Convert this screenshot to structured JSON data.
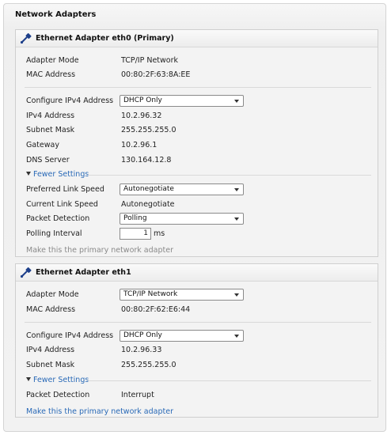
{
  "page": {
    "title": "Network Adapters"
  },
  "eth0": {
    "title": "Ethernet Adapter eth0 (Primary)",
    "adapter_mode_label": "Adapter Mode",
    "adapter_mode_value": "TCP/IP Network",
    "mac_label": "MAC Address",
    "mac_value": "00:80:2F:63:8A:EE",
    "configure_label": "Configure IPv4 Address",
    "configure_value": "DHCP Only",
    "ipv4_label": "IPv4 Address",
    "ipv4_value": "10.2.96.32",
    "subnet_label": "Subnet Mask",
    "subnet_value": "255.255.255.0",
    "gateway_label": "Gateway",
    "gateway_value": "10.2.96.1",
    "dns_label": "DNS Server",
    "dns_value": "130.164.12.8",
    "fewer_settings": "Fewer Settings",
    "link_speed_label": "Preferred Link Speed",
    "link_speed_value": "Autonegotiate",
    "current_speed_label": "Current Link Speed",
    "current_speed_value": "Autonegotiate",
    "packet_label": "Packet Detection",
    "packet_value": "Polling",
    "polling_label": "Polling Interval",
    "polling_value": "1",
    "polling_unit": "ms",
    "make_primary": "Make this the primary network adapter"
  },
  "eth1": {
    "title": "Ethernet Adapter eth1",
    "adapter_mode_label": "Adapter Mode",
    "adapter_mode_value": "TCP/IP Network",
    "mac_label": "MAC Address",
    "mac_value": "00:80:2F:62:E6:44",
    "configure_label": "Configure IPv4 Address",
    "configure_value": "DHCP Only",
    "ipv4_label": "IPv4 Address",
    "ipv4_value": "10.2.96.33",
    "subnet_label": "Subnet Mask",
    "subnet_value": "255.255.255.0",
    "fewer_settings": "Fewer Settings",
    "packet_label": "Packet Detection",
    "packet_value": "Interrupt",
    "make_primary": "Make this the primary network adapter"
  }
}
